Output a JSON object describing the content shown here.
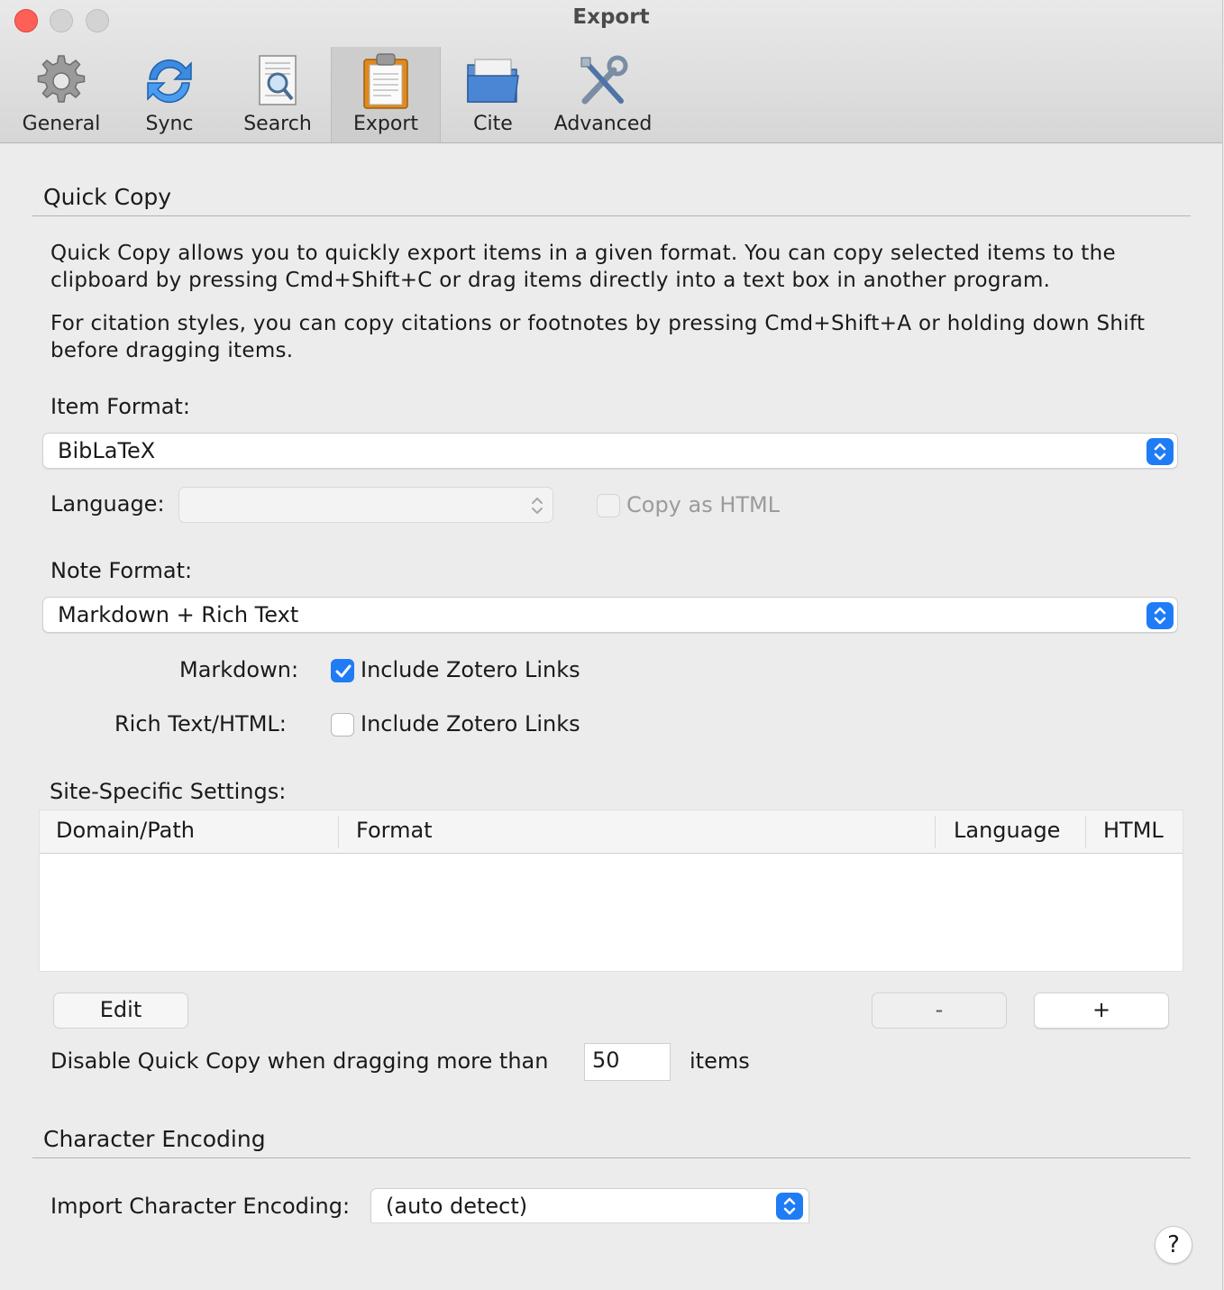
{
  "window": {
    "title": "Export"
  },
  "toolbar": {
    "tabs": [
      {
        "label": "General",
        "icon": "gear-icon"
      },
      {
        "label": "Sync",
        "icon": "sync-icon"
      },
      {
        "label": "Search",
        "icon": "search-document-icon"
      },
      {
        "label": "Export",
        "icon": "clipboard-icon",
        "selected": true
      },
      {
        "label": "Cite",
        "icon": "folder-icon"
      },
      {
        "label": "Advanced",
        "icon": "tools-icon"
      }
    ]
  },
  "quick_copy": {
    "title": "Quick Copy",
    "desc1_line1": "Quick Copy allows you to quickly export items in a given format. You can copy selected items to the",
    "desc1_line2": "clipboard by pressing Cmd+Shift+C or drag items directly into a text box in another program.",
    "desc2_line1": "For citation styles, you can copy citations or footnotes by pressing Cmd+Shift+A or holding down Shift",
    "desc2_line2": "before dragging items.",
    "item_format_label": "Item Format:",
    "item_format_value": "BibLaTeX",
    "language_label": "Language:",
    "language_value": "",
    "copy_as_html_label": "Copy as HTML",
    "copy_as_html_checked": false,
    "note_format_label": "Note Format:",
    "note_format_value": "Markdown + Rich Text",
    "markdown_label": "Markdown:",
    "markdown_option_label": "Include Zotero Links",
    "markdown_option_checked": true,
    "richtext_label": "Rich Text/HTML:",
    "richtext_option_label": "Include Zotero Links",
    "richtext_option_checked": false
  },
  "site_specific": {
    "title": "Site-Specific Settings:",
    "columns": [
      "Domain/Path",
      "Format",
      "Language",
      "HTML"
    ],
    "rows": [],
    "edit_button": "Edit",
    "remove_button": "-",
    "add_button": "+"
  },
  "drag_limit": {
    "prefix": "Disable Quick Copy when dragging more than",
    "value": "50",
    "suffix": "items"
  },
  "character_encoding": {
    "title": "Character Encoding",
    "import_label": "Import Character Encoding:",
    "import_value": "(auto detect)"
  },
  "help_button": "?",
  "colors": {
    "accent": "#1f7cf5",
    "close_button": "#fe5f57"
  }
}
